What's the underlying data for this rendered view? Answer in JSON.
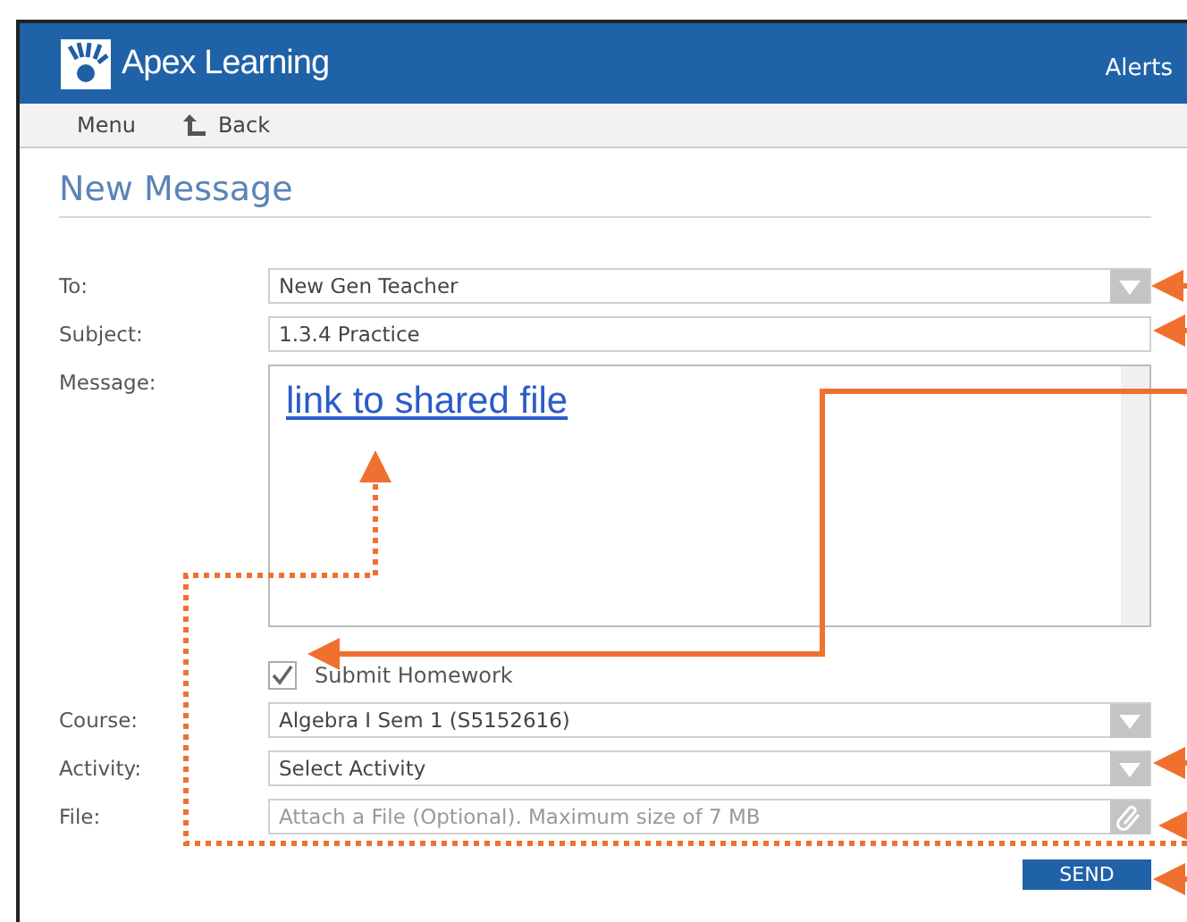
{
  "header": {
    "logo": "Apex Learning",
    "alerts": "Alerts"
  },
  "nav": {
    "menu": "Menu",
    "back": "Back"
  },
  "title": "New Message",
  "fields": [
    {
      "kind": "dropdown",
      "label": "To:",
      "value": "New Gen Teacher"
    },
    {
      "kind": "text",
      "label": "Subject:",
      "value": "1.3.4 Practice"
    },
    {
      "kind": "textarea",
      "label": "Message:",
      "link": "link to shared file"
    },
    {
      "kind": "checkbox",
      "text": "Submit Homework",
      "checked": true
    },
    {
      "kind": "dropdown",
      "label": "Course:",
      "value": "Algebra I Sem 1 (S5152616)"
    },
    {
      "kind": "dropdown",
      "label": "Activity:",
      "value": "Select Activity"
    },
    {
      "kind": "file",
      "label": "File:",
      "placeholder": "Attach a File (Optional). Maximum size of 7 MB"
    }
  ],
  "send": "SEND"
}
